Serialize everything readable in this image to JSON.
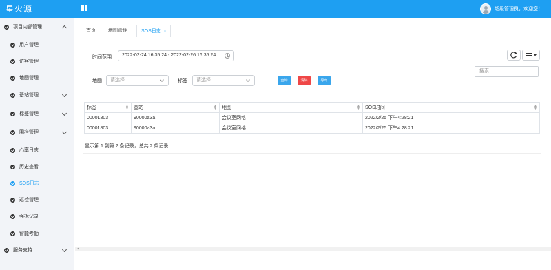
{
  "header": {
    "brand": "星火源",
    "user_text": "超级管理员，欢迎您！"
  },
  "sidebar": {
    "items": [
      {
        "label": "项目内部管理",
        "icon": "check-circle-icon",
        "level": "top",
        "chevron": "up"
      },
      {
        "label": "用户管理",
        "icon": "check-circle-icon",
        "level": "sub"
      },
      {
        "label": "访客管理",
        "icon": "check-circle-icon",
        "level": "sub"
      },
      {
        "label": "地图管理",
        "icon": "check-circle-icon",
        "level": "sub"
      },
      {
        "label": "基站管理",
        "icon": "check-circle-icon",
        "level": "sub",
        "chevron": "down"
      },
      {
        "label": "标签管理",
        "icon": "check-circle-icon",
        "level": "sub",
        "chevron": "down"
      },
      {
        "label": "围栏管理",
        "icon": "check-circle-icon",
        "level": "sub",
        "chevron": "down"
      },
      {
        "label": "心率日志",
        "icon": "check-circle-icon",
        "level": "sub"
      },
      {
        "label": "历史查看",
        "icon": "check-circle-icon",
        "level": "sub"
      },
      {
        "label": "SOS日志",
        "icon": "check-circle-icon",
        "level": "sub",
        "active": true
      },
      {
        "label": "巡检管理",
        "icon": "check-circle-icon",
        "level": "sub"
      },
      {
        "label": "强拆记录",
        "icon": "check-circle-icon",
        "level": "sub"
      },
      {
        "label": "智能考勤",
        "icon": "check-circle-icon",
        "level": "sub"
      },
      {
        "label": "服务支持",
        "icon": "check-circle-icon",
        "level": "top",
        "chevron": "down"
      }
    ]
  },
  "tabs": [
    {
      "label": "首页"
    },
    {
      "label": "地图管理"
    },
    {
      "label": "SOS日志",
      "close": "x",
      "active": true
    }
  ],
  "filters": {
    "time_label": "时间范围",
    "time_value": "2022-02-24 16:35:24 - 2022-02-26 16:35:24",
    "map_label": "地图",
    "map_placeholder": "请选择",
    "tag_label": "标签",
    "tag_placeholder": "请选择",
    "query_button": "查询",
    "clear_button": "清除",
    "export_button": "导出",
    "search_placeholder": "搜索"
  },
  "table": {
    "columns": [
      "标签",
      "基站",
      "地图",
      "SOS时间"
    ],
    "rows": [
      [
        "00001803",
        "90000a3a",
        "会议室网格",
        "2022/2/25 下午4:28:21"
      ],
      [
        "00001803",
        "90000a3a",
        "会议室网格",
        "2022/2/25 下午4:28:21"
      ]
    ],
    "footer": "显示第 1 到第 2 条记录，总共 2 条记录"
  },
  "colors": {
    "primary": "#1e9ff2",
    "danger": "#ef4747",
    "sidebar_bg": "#f2f4f8"
  }
}
